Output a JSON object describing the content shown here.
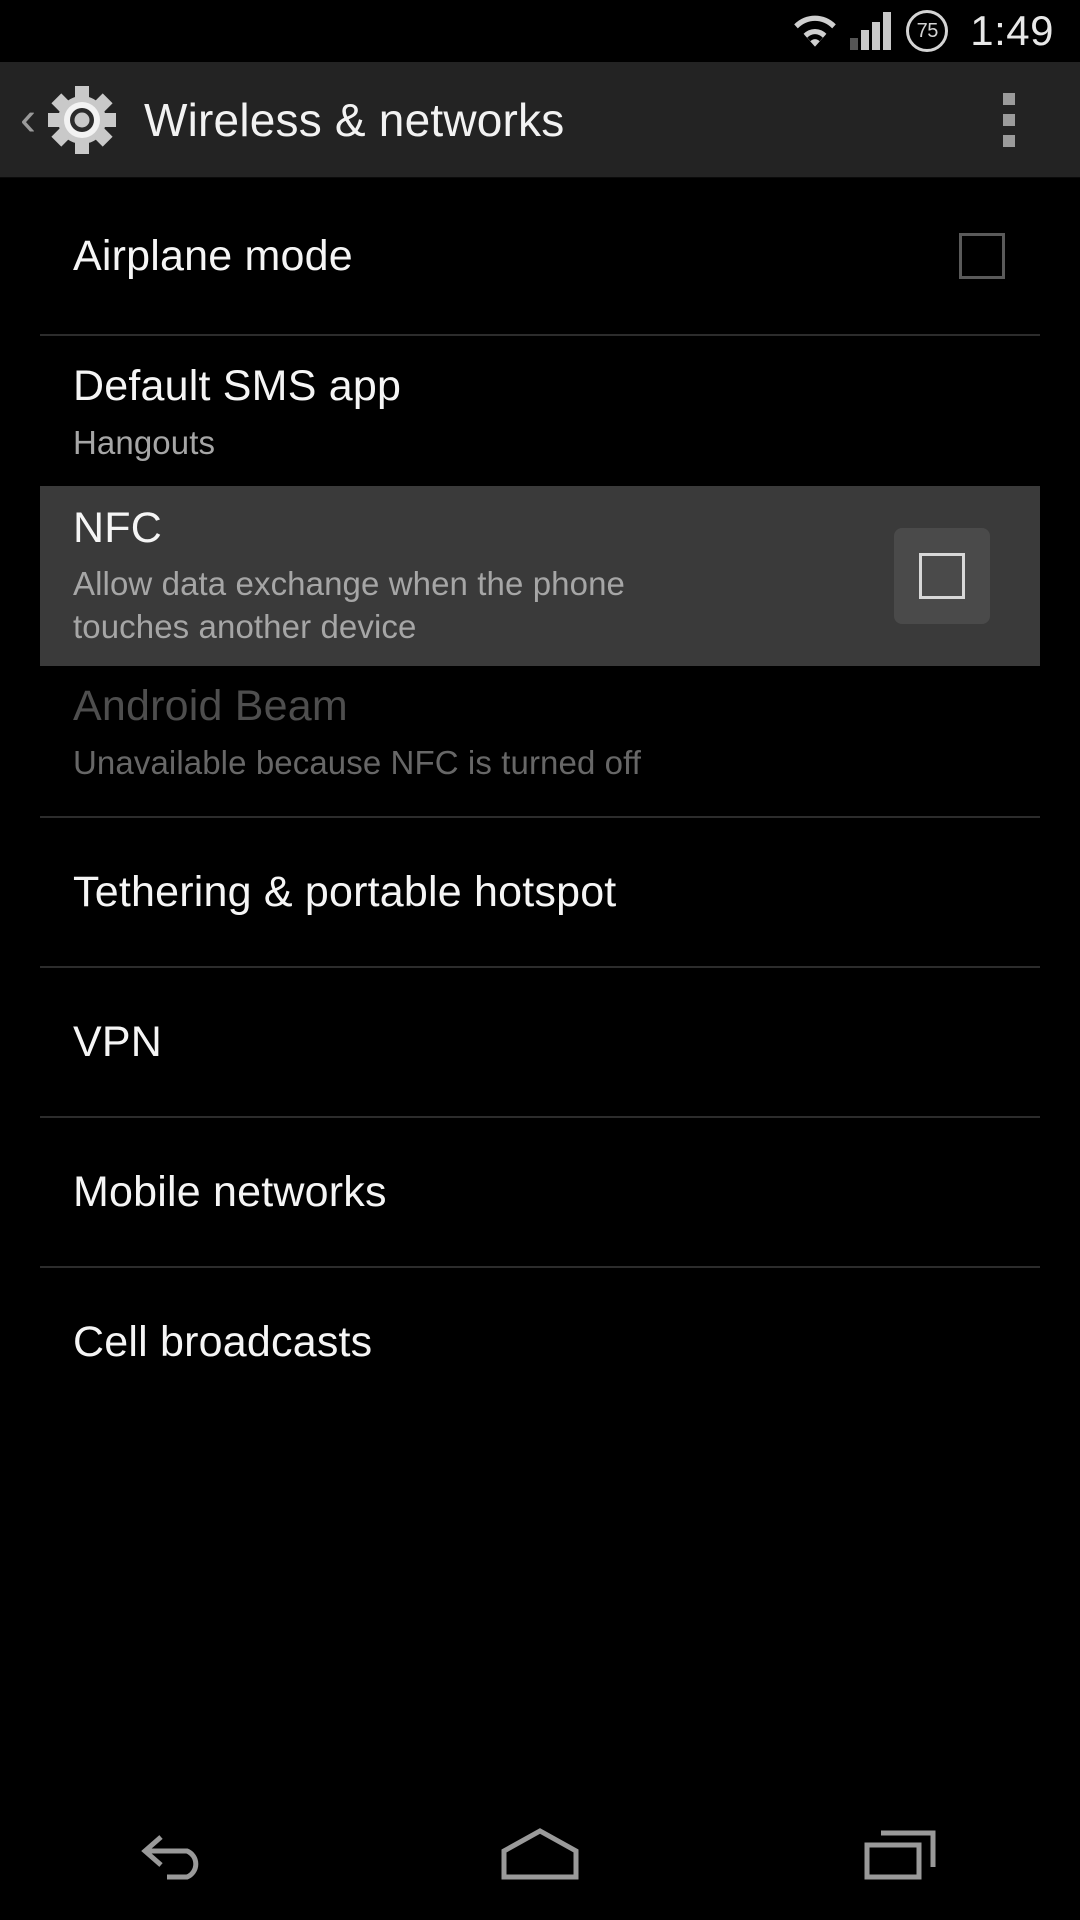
{
  "status_bar": {
    "wifi_icon": "wifi-icon",
    "signal_icon": "cell-signal-icon",
    "signal_bars_active": 3,
    "battery_icon": "battery-circle-icon",
    "battery_percent": "75",
    "time": "1:49"
  },
  "action_bar": {
    "up_chevron": "‹",
    "app_icon": "settings-gear-icon",
    "title": "Wireless & networks",
    "overflow_icon": "overflow-menu-icon"
  },
  "list": {
    "items": [
      {
        "id": "airplane-mode",
        "title": "Airplane mode",
        "subtitle": null,
        "control": "checkbox",
        "checked": false,
        "pressed": false,
        "disabled": false,
        "highlighted": false,
        "divider_after": true
      },
      {
        "id": "default-sms-app",
        "title": "Default SMS app",
        "subtitle": "Hangouts",
        "control": null,
        "checked": null,
        "pressed": false,
        "disabled": false,
        "highlighted": false,
        "divider_after": false
      },
      {
        "id": "nfc",
        "title": "NFC",
        "subtitle": "Allow data exchange when the phone touches another device",
        "control": "checkbox",
        "checked": false,
        "pressed": true,
        "disabled": false,
        "highlighted": true,
        "divider_after": false
      },
      {
        "id": "android-beam",
        "title": "Android Beam",
        "subtitle": "Unavailable because NFC is turned off",
        "control": null,
        "checked": null,
        "pressed": false,
        "disabled": true,
        "highlighted": false,
        "divider_after": true
      },
      {
        "id": "tethering-portable-hotspot",
        "title": "Tethering & portable hotspot",
        "subtitle": null,
        "control": null,
        "checked": null,
        "pressed": false,
        "disabled": false,
        "highlighted": false,
        "divider_after": true
      },
      {
        "id": "vpn",
        "title": "VPN",
        "subtitle": null,
        "control": null,
        "checked": null,
        "pressed": false,
        "disabled": false,
        "highlighted": false,
        "divider_after": true
      },
      {
        "id": "mobile-networks",
        "title": "Mobile networks",
        "subtitle": null,
        "control": null,
        "checked": null,
        "pressed": false,
        "disabled": false,
        "highlighted": false,
        "divider_after": true
      },
      {
        "id": "cell-broadcasts",
        "title": "Cell broadcasts",
        "subtitle": null,
        "control": null,
        "checked": null,
        "pressed": false,
        "disabled": false,
        "highlighted": false,
        "divider_after": false
      }
    ]
  },
  "nav_bar": {
    "back_icon": "back-arrow-icon",
    "home_icon": "home-icon",
    "recents_icon": "recent-apps-icon"
  },
  "colors": {
    "background": "#000000",
    "action_bar": "#232323",
    "highlight_row": "#3a3a3a",
    "pressed_control": "#4a4a4a",
    "primary_text": "#f5f5f5",
    "secondary_text": "#a6a6a6",
    "disabled_text": "#4e4e4e",
    "divider": "#2c2c2c"
  }
}
